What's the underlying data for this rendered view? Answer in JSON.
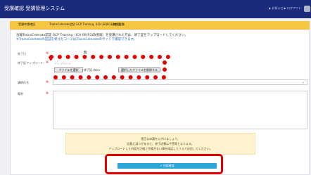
{
  "app": {
    "title": "受講確認 受講管理システム",
    "header_links": "▶ お知らせ ▶ ログアウト"
  },
  "tabs": [
    {
      "label": "受講申請確認"
    },
    {
      "label": "TrainsCelerate認証 GCP Training（ICH E6(R3)改善版）"
    },
    {
      "label": "終了証書"
    }
  ],
  "form": {
    "notice": "治験TrainsCelerate認証 GCP Training（ICH E6(R3)改善版）を受講された方は、修了証をアップロードしてください。",
    "notice_link": "※TrainsCelerateの認証を受けたコースはTrainsCelerateのサイトで確認できます。",
    "amount_label": "修了日",
    "amount_value": "無",
    "upload_label": "修了証アップロード",
    "upload_status": "アップロード",
    "file_button": "ファイルを選択",
    "file_name": "修了証.docx",
    "delete_button": "選択したファイルを削除する",
    "select_label": "講師氏名",
    "remarks_label": "備考",
    "required_mark": "※"
  },
  "confirmation": {
    "line1": "適正な申請を心がけましょう。",
    "line2": "記載に誤りがあると、修了証書は不受理となります。",
    "line3": "アップロードした内容が正確で不備がない事を確認したうえで送信してください。"
  },
  "submit_label": "✔ 内容確認"
}
